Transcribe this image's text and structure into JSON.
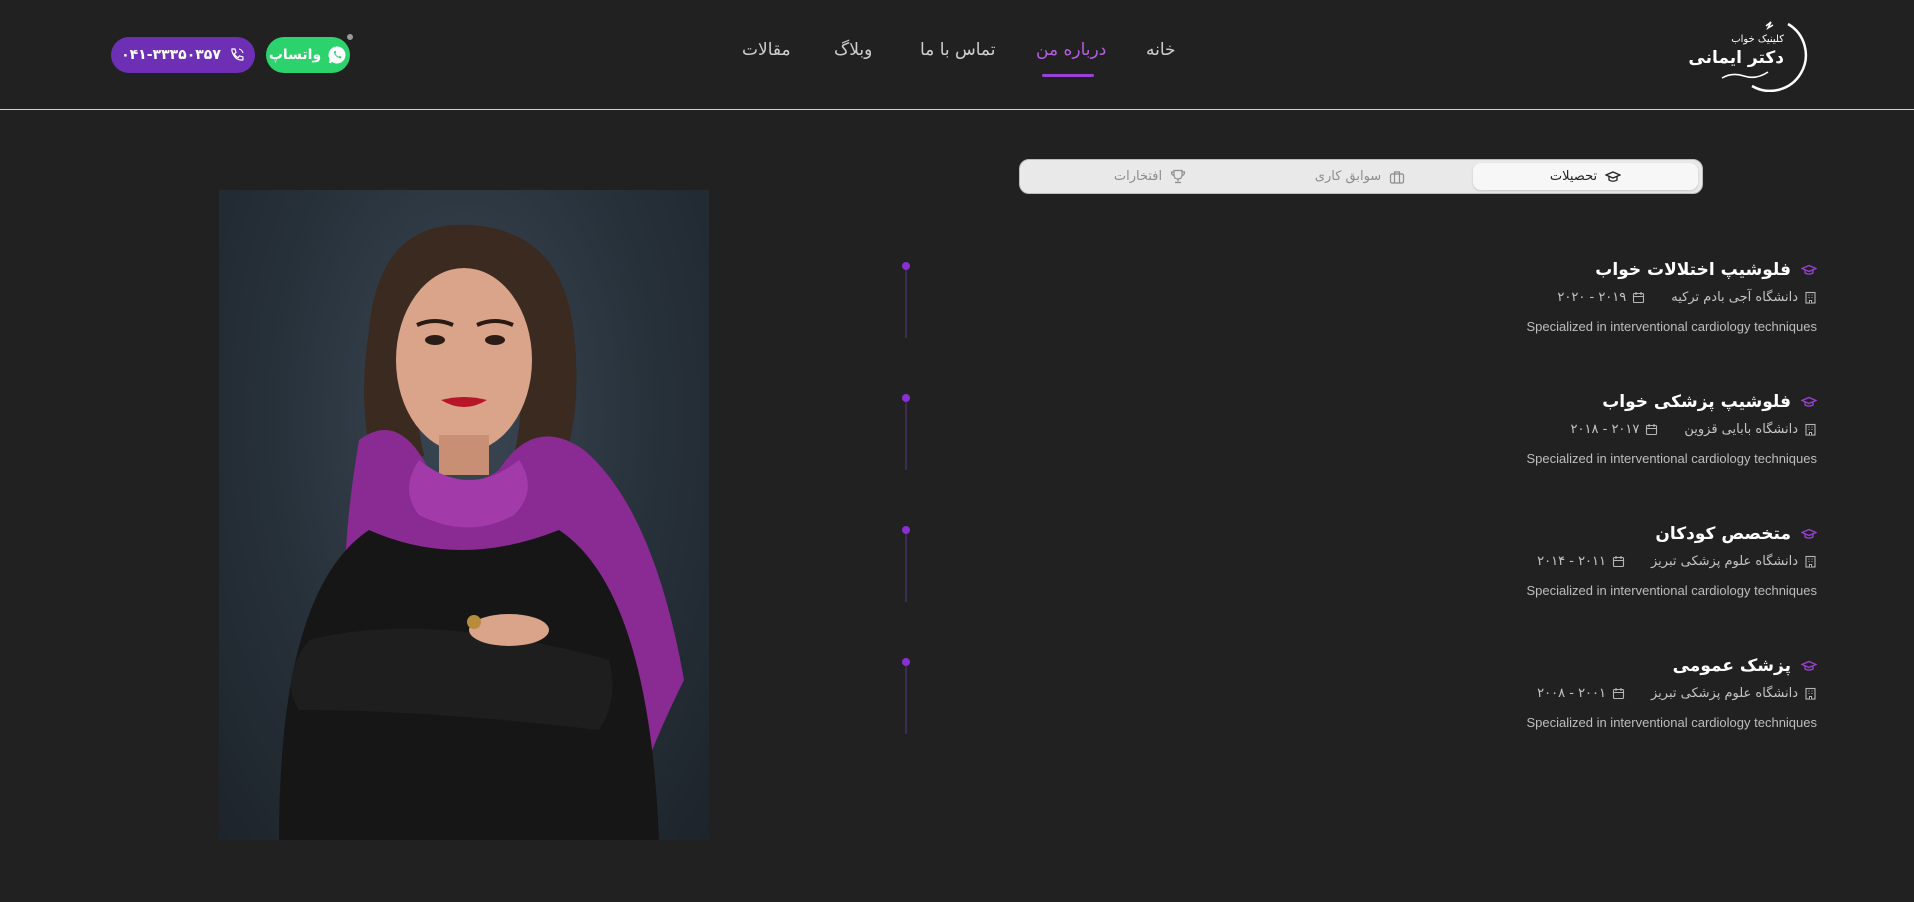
{
  "header": {
    "logo": {
      "small": "کلینیک خواب",
      "big": "دکتر ایمانی"
    },
    "nav": [
      {
        "label": "خانه",
        "active": false
      },
      {
        "label": "درباره من",
        "active": true
      },
      {
        "label": "تماس با ما",
        "active": false
      },
      {
        "label": "وبلاگ",
        "active": false
      },
      {
        "label": "مقالات",
        "active": false
      }
    ],
    "whatsapp_label": "واتساپ",
    "phone_label": "۰۴۱-۳۳۳۵۰۳۵۷"
  },
  "tabs": [
    {
      "label": "تحصیلات",
      "icon": "graduation-cap-icon",
      "active": true
    },
    {
      "label": "سوابق کاری",
      "icon": "briefcase-icon",
      "active": false
    },
    {
      "label": "افتخارات",
      "icon": "trophy-icon",
      "active": false
    }
  ],
  "education": [
    {
      "title": "فلوشیپ اختلالات خواب",
      "institution": "دانشگاه آجی بادم ترکیه",
      "years": "۲۰۱۹ - ۲۰۲۰",
      "description": "Specialized in interventional cardiology techniques"
    },
    {
      "title": "فلوشیپ پزشکی خواب",
      "institution": "دانشگاه بابایی قزوین",
      "years": "۲۰۱۷ - ۲۰۱۸",
      "description": "Specialized in interventional cardiology techniques"
    },
    {
      "title": "متخصص کودکان",
      "institution": "دانشگاه علوم پزشکی تبریز",
      "years": "۲۰۱۱ - ۲۰۱۴",
      "description": "Specialized in interventional cardiology techniques"
    },
    {
      "title": "پزشک عمومی",
      "institution": "دانشگاه علوم پزشکی تبریز",
      "years": "۲۰۰۱ - ۲۰۰۸",
      "description": "Specialized in interventional cardiology techniques"
    }
  ],
  "colors": {
    "background": "#212121",
    "accent": "#9a41d6",
    "whatsapp": "#2cd26b",
    "phone_button": "#6d2fb4"
  }
}
